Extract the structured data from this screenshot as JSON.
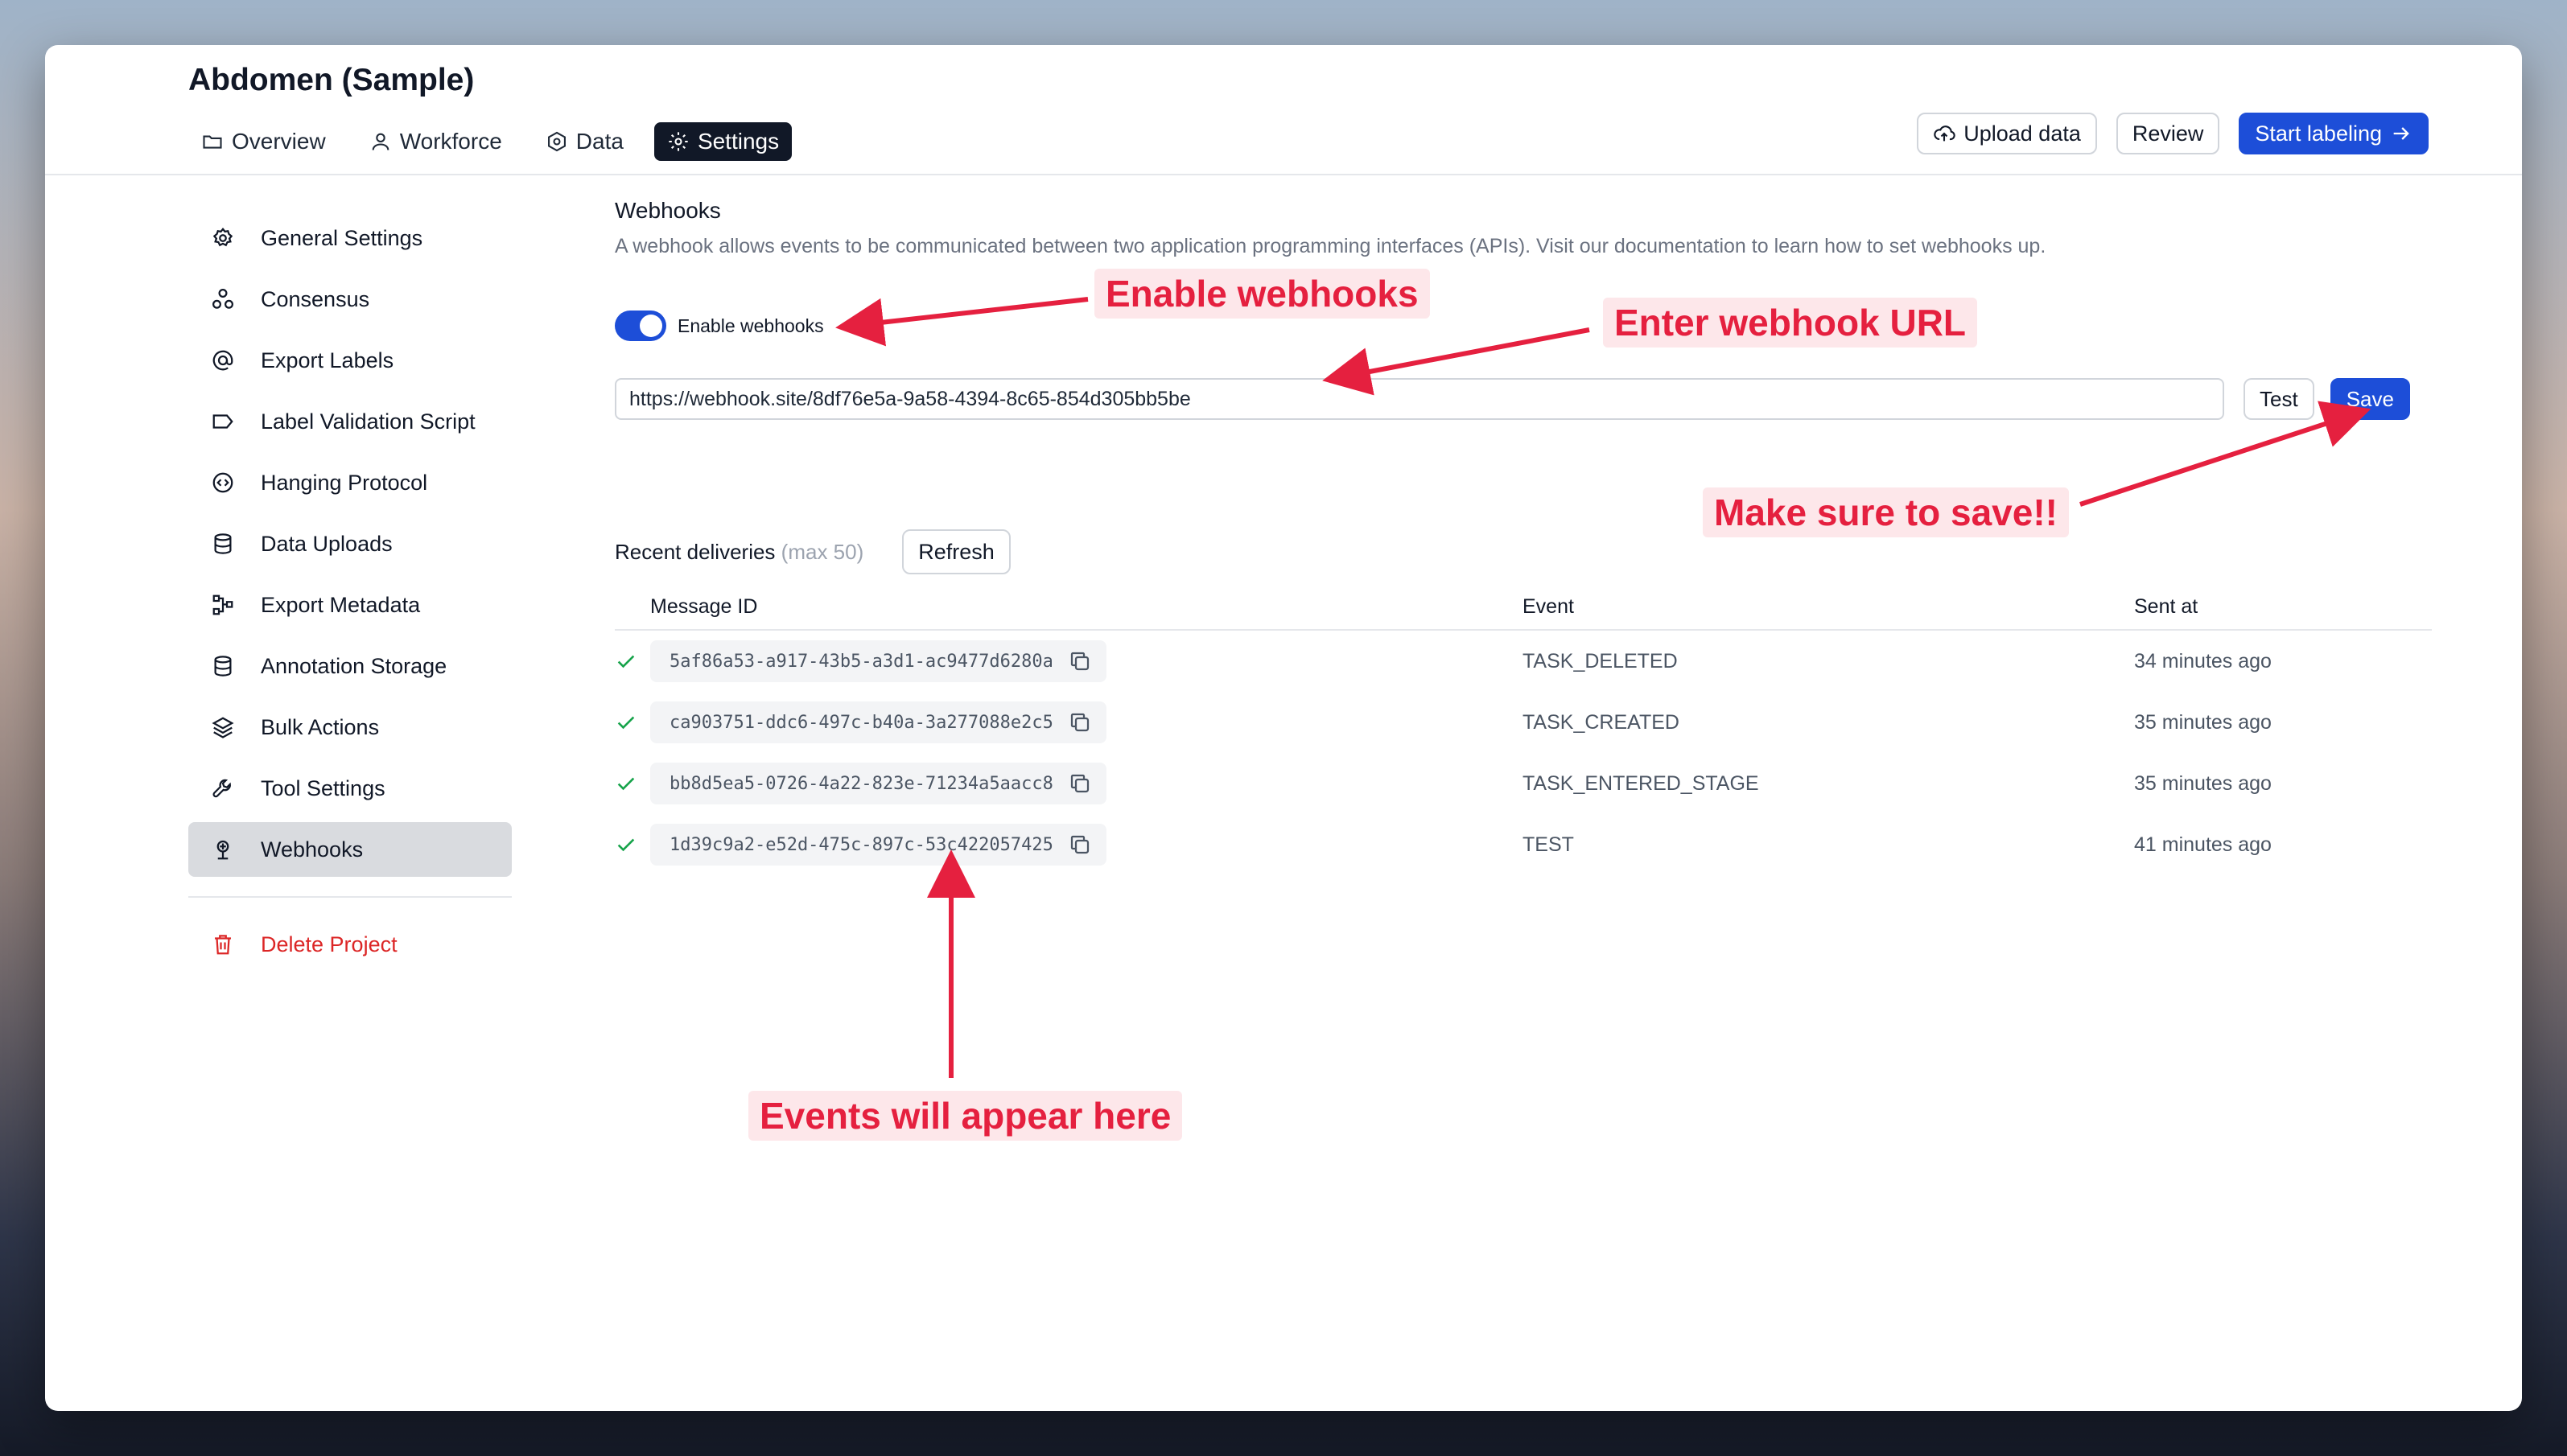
{
  "project": {
    "title": "Abdomen (Sample)"
  },
  "tabs": [
    {
      "label": "Overview",
      "icon": "folder-icon"
    },
    {
      "label": "Workforce",
      "icon": "user-icon"
    },
    {
      "label": "Data",
      "icon": "hexagon-icon"
    },
    {
      "label": "Settings",
      "icon": "gear-icon",
      "active": true
    }
  ],
  "header_actions": {
    "upload_label": "Upload data",
    "review_label": "Review",
    "start_label": "Start labeling"
  },
  "sidebar": {
    "items": [
      {
        "label": "General Settings",
        "icon": "gear-icon"
      },
      {
        "label": "Consensus",
        "icon": "users-icon"
      },
      {
        "label": "Export Labels",
        "icon": "at-sign-icon"
      },
      {
        "label": "Label Validation Script",
        "icon": "tag-icon"
      },
      {
        "label": "Hanging Protocol",
        "icon": "code-circle-icon"
      },
      {
        "label": "Data Uploads",
        "icon": "database-icon"
      },
      {
        "label": "Export Metadata",
        "icon": "share-nodes-icon"
      },
      {
        "label": "Annotation Storage",
        "icon": "database-icon"
      },
      {
        "label": "Bulk Actions",
        "icon": "layers-icon"
      },
      {
        "label": "Tool Settings",
        "icon": "wrench-icon"
      },
      {
        "label": "Webhooks",
        "icon": "webhook-icon",
        "active": true
      }
    ],
    "delete_label": "Delete Project"
  },
  "webhooks": {
    "title": "Webhooks",
    "description": "A webhook allows events to be communicated between two application programming interfaces (APIs). Visit our documentation to learn how to set webhooks up.",
    "toggle_label": "Enable webhooks",
    "toggle_on": true,
    "url_value": "https://webhook.site/8df76e5a-9a58-4394-8c65-854d305bb5be",
    "test_label": "Test",
    "save_label": "Save",
    "recent_title": "Recent deliveries",
    "recent_max": "(max 50)",
    "refresh_label": "Refresh",
    "columns": {
      "message_id": "Message ID",
      "event": "Event",
      "sent_at": "Sent at"
    },
    "rows": [
      {
        "id": "5af86a53-a917-43b5-a3d1-ac9477d6280a",
        "event": "TASK_DELETED",
        "sent": "34 minutes ago"
      },
      {
        "id": "ca903751-ddc6-497c-b40a-3a277088e2c5",
        "event": "TASK_CREATED",
        "sent": "35 minutes ago"
      },
      {
        "id": "bb8d5ea5-0726-4a22-823e-71234a5aacc8",
        "event": "TASK_ENTERED_STAGE",
        "sent": "35 minutes ago"
      },
      {
        "id": "1d39c9a2-e52d-475c-897c-53c422057425",
        "event": "TEST",
        "sent": "41 minutes ago"
      }
    ]
  },
  "annotations": {
    "enable": "Enable webhooks",
    "url": "Enter webhook URL",
    "save": "Make sure to save!!",
    "events": "Events will appear here"
  },
  "colors": {
    "accent": "#1d4ed8",
    "annotation": "#e5203f",
    "danger": "#dc2626",
    "success": "#16a34a"
  }
}
